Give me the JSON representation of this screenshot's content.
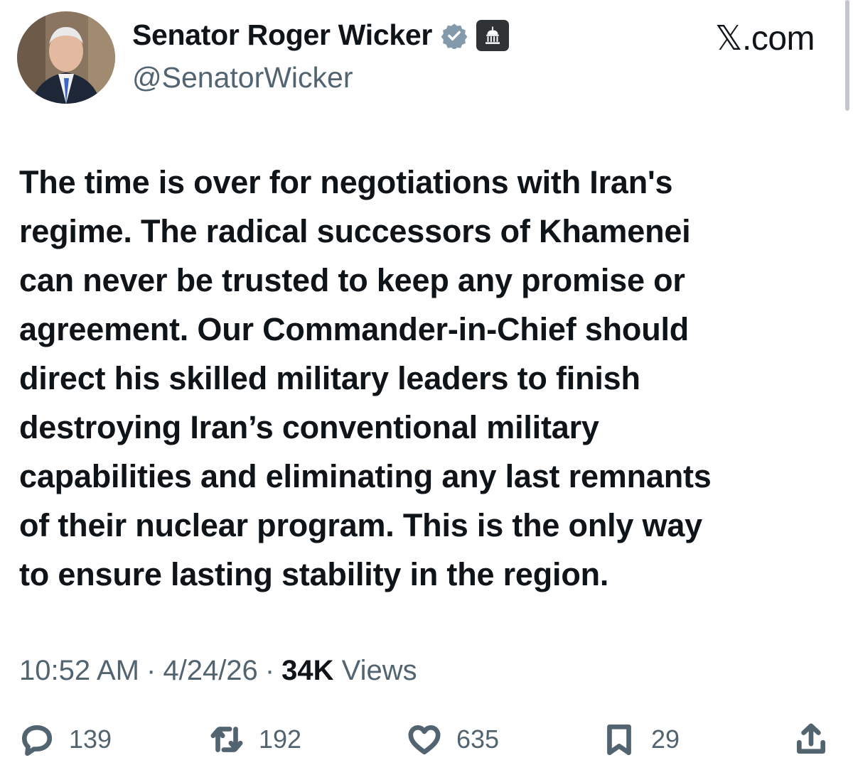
{
  "author": {
    "name": "Senator Roger Wicker",
    "handle": "@SenatorWicker",
    "verified_color": "#829aab"
  },
  "brand": "𝕏.com",
  "tweet": {
    "text": "The time is over for negotiations with Iran's\nregime. The radical successors of Khamenei\ncan never be trusted to keep any promise or\nagreement. Our Commander-in-Chief should\ndirect his skilled military leaders to finish\ndestroying Iran’s conventional military\ncapabilities and eliminating any last remnants\nof their nuclear program. This is the only way\nto ensure lasting stability in the region."
  },
  "meta": {
    "time": "10:52 AM",
    "sep": "·",
    "date": "4/24/26",
    "views_count": "34K",
    "views_label": "Views"
  },
  "actions": {
    "replies": "139",
    "reposts": "192",
    "likes": "635",
    "bookmarks": "29"
  },
  "icons": [
    "verified-icon",
    "government-building-icon",
    "reply-icon",
    "repost-icon",
    "like-icon",
    "bookmark-icon",
    "share-icon"
  ]
}
